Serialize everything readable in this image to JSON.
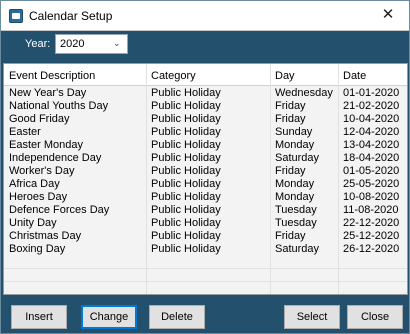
{
  "window": {
    "title": "Calendar Setup",
    "close_glyph": "✕"
  },
  "year": {
    "label": "Year:",
    "value": "2020",
    "chevron": "⌄"
  },
  "grid": {
    "columns": [
      "Event Description",
      "Category",
      "Day",
      "Date"
    ],
    "rows": [
      [
        "New Year's Day",
        "Public Holiday",
        "Wednesday",
        "01-01-2020"
      ],
      [
        "National Youths Day",
        "Public Holiday",
        "Friday",
        "21-02-2020"
      ],
      [
        "Good Friday",
        "Public Holiday",
        "Friday",
        "10-04-2020"
      ],
      [
        "Easter",
        "Public Holiday",
        "Sunday",
        "12-04-2020"
      ],
      [
        "Easter Monday",
        "Public Holiday",
        "Monday",
        "13-04-2020"
      ],
      [
        "Independence Day",
        "Public Holiday",
        "Saturday",
        "18-04-2020"
      ],
      [
        "Worker's Day",
        "Public Holiday",
        "Friday",
        "01-05-2020"
      ],
      [
        "Africa Day",
        "Public Holiday",
        "Monday",
        "25-05-2020"
      ],
      [
        "Heroes Day",
        "Public Holiday",
        "Monday",
        "10-08-2020"
      ],
      [
        "Defence Forces Day",
        "Public Holiday",
        "Tuesday",
        "11-08-2020"
      ],
      [
        "Unity Day",
        "Public Holiday",
        "Tuesday",
        "22-12-2020"
      ],
      [
        "Christmas Day",
        "Public Holiday",
        "Friday",
        "25-12-2020"
      ],
      [
        "Boxing Day",
        "Public Holiday",
        "Saturday",
        "26-12-2020"
      ]
    ]
  },
  "buttons": {
    "insert": "Insert",
    "change": "Change",
    "delete": "Delete",
    "select": "Select",
    "close": "Close"
  },
  "colors": {
    "window_bg": "#22506d",
    "focus_border": "#0078d7"
  }
}
